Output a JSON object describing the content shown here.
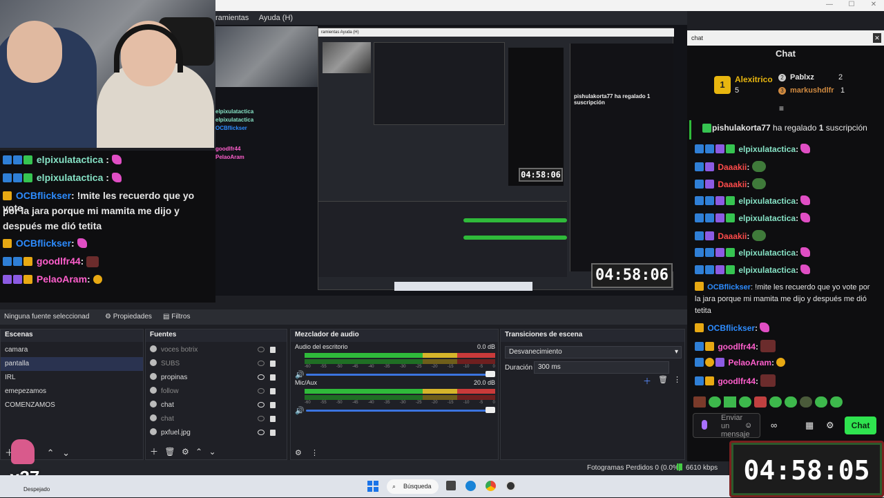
{
  "menu": [
    "ramientas",
    "Ayuda (H)"
  ],
  "preview_menu": "ramientas   Ayuda (H)",
  "left_chat": [
    {
      "user": "elpixulatactica",
      "sep": " :",
      "text": "",
      "color": "green"
    },
    {
      "user": "elpixulatactica",
      "sep": " :",
      "text": "",
      "color": "green"
    },
    {
      "user": "OCBflickser",
      "sep": ":",
      "text": " !mite les recuerdo que yo vote",
      "color": "blue"
    },
    {
      "line": "por la jara porque mi mamita me dijo y"
    },
    {
      "line": "después me dió tetita"
    },
    {
      "user": "OCBflickser",
      "sep": ":",
      "text": "",
      "color": "blue"
    },
    {
      "user": "goodlfr44",
      "sep": ":",
      "text": "",
      "color": "pink"
    },
    {
      "user": "PelaoAram",
      "sep": ":",
      "text": "",
      "color": "pink"
    }
  ],
  "preview_mini_chat": [
    "elpixulatactica",
    "elpixulatactica",
    "OCBflickser",
    "goodlfr44",
    "PelaoAram"
  ],
  "preview_clock": "04:58:06",
  "preview_sub_msg": "pishulakorta77 ha regalado 1 suscripción",
  "props": {
    "no_source": "Ninguna fuente seleccionad",
    "properties": "Propiedades",
    "filters": "Filtros"
  },
  "scenes": {
    "title": "Escenas",
    "items": [
      "camara",
      "pantalla",
      "IRL",
      "emepezamos",
      "COMENZAMOS"
    ],
    "selected": 1
  },
  "sources": {
    "title": "Fuentes",
    "items": [
      {
        "name": "voces botrix",
        "visible": false
      },
      {
        "name": "SUBS",
        "visible": false
      },
      {
        "name": "propinas",
        "visible": true
      },
      {
        "name": "follow",
        "visible": false
      },
      {
        "name": "chat",
        "visible": true
      },
      {
        "name": "chat",
        "visible": false
      },
      {
        "name": "pxfuel.jpg",
        "visible": true
      }
    ]
  },
  "mixer": {
    "title": "Mezclador de audio",
    "channels": [
      {
        "name": "Audio del escritorio",
        "db": "0.0 dB"
      },
      {
        "name": "Mic/Aux",
        "db": "20.0 dB"
      }
    ],
    "scale": [
      "-60",
      "-55",
      "-50",
      "-45",
      "-40",
      "-35",
      "-30",
      "-25",
      "-20",
      "-15",
      "-10",
      "-5",
      "0"
    ]
  },
  "transitions": {
    "title": "Transiciones de escena",
    "type": "Desvanecimiento",
    "duration_label": "Duración",
    "duration_value": "300 ms"
  },
  "status": {
    "dropped": "Fotogramas Perdidos 0 (0.0%)",
    "kbps": "6610 kbps"
  },
  "taskbar": {
    "search": "Búsqueda",
    "weather": "Despejado"
  },
  "x37": "x37",
  "right_chat": {
    "window_title": "chat",
    "header": "Chat",
    "leaderboard": [
      {
        "rank": "1",
        "name": "Alexitrico",
        "count": "5"
      },
      {
        "rank": "2",
        "name": "Pablxz",
        "count": "2"
      },
      {
        "rank": "3",
        "name": "markushdlfr",
        "count": "1"
      }
    ],
    "sub_msg_user": "pishulakorta77",
    "sub_msg_pre": " ha regalado ",
    "sub_msg_num": "1",
    "sub_msg_post": " suscripción",
    "messages": [
      {
        "user": "elpixulatactica",
        "sep": ":",
        "color": "green",
        "emote": "pink"
      },
      {
        "user": "Daaakii",
        "sep": ":",
        "color": "red",
        "emote": "frog"
      },
      {
        "user": "Daaakii",
        "sep": ":",
        "color": "red",
        "emote": "frog"
      },
      {
        "user": "elpixulatactica",
        "sep": ":",
        "color": "green",
        "emote": "pink"
      },
      {
        "user": "elpixulatactica",
        "sep": ":",
        "color": "green",
        "emote": "pink"
      },
      {
        "user": "Daaakii",
        "sep": ":",
        "color": "red",
        "emote": "frog"
      },
      {
        "user": "elpixulatactica",
        "sep": ":",
        "color": "green",
        "emote": "pink"
      },
      {
        "user": "elpixulatactica",
        "sep": ":",
        "color": "green",
        "emote": "pink"
      }
    ],
    "long_msg_user": "OCBflickser",
    "long_msg_text": ": !mite les recuerdo que yo vote por la jara porque mi mamita me dijo y después me dió tetita",
    "tail": [
      {
        "user": "OCBflickser",
        "sep": ":",
        "color": "blue",
        "emote": "pink"
      },
      {
        "user": "goodlfr44",
        "sep": ":",
        "color": "pink",
        "emote": "face"
      },
      {
        "user": "PelaoAram",
        "sep": ":",
        "color": "pink",
        "emote": "pink"
      },
      {
        "user": "goodlfr44",
        "sep": ":",
        "color": "pink",
        "emote": "face"
      }
    ],
    "input_placeholder": "Enviar un mensaje",
    "chat_button": "Chat"
  },
  "big_clock": "04:58:05"
}
